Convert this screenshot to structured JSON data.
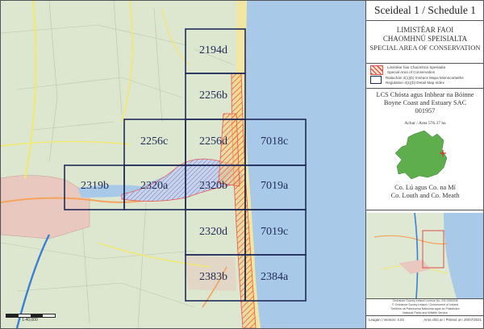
{
  "map": {
    "tiles": [
      {
        "id": "2194d",
        "label": "2194d"
      },
      {
        "id": "2256b",
        "label": "2256b"
      },
      {
        "id": "2256c",
        "label": "2256c"
      },
      {
        "id": "2256d",
        "label": "2256d"
      },
      {
        "id": "7018c",
        "label": "7018c"
      },
      {
        "id": "2319b",
        "label": "2319b"
      },
      {
        "id": "2320a",
        "label": "2320a"
      },
      {
        "id": "2320b",
        "label": "2320b"
      },
      {
        "id": "7019a",
        "label": "7019a"
      },
      {
        "id": "2320d",
        "label": "2320d"
      },
      {
        "id": "7019c",
        "label": "7019c"
      },
      {
        "id": "2383b",
        "label": "2383b"
      },
      {
        "id": "2384a",
        "label": "2384a"
      }
    ],
    "scale_text": "1:40,000",
    "colors": {
      "sea": "#a8c9e8",
      "land": "#dde6cf",
      "grid": "#1f2b57",
      "sac_hatch": "#e8544f",
      "sac_fill": "#f3d27a",
      "sand": "#f3e6a3"
    }
  },
  "panel": {
    "title": "Sceideal 1 / Schedule 1",
    "heading_ga_1": "LIMISTÉAR FAOI",
    "heading_ga_2": "CHAOMHNÚ SPEISIALTA",
    "heading_en": "SPECIAL AREA OF CONSERVATION",
    "legend": [
      {
        "text_ga": "Limistéar faoi Chaomhnú Speisialta",
        "text_en": "Special Area of Conservation"
      },
      {
        "text_ga": "Rialachán 4(1)(b) Innéacs Mapa Mionscartaithe",
        "text_en": "Regulation 4(1)(b) Detail Map Index"
      }
    ],
    "site_ga": "LCS Chósta agus Inbhear na Bóinne",
    "site_en": "Boyne Coast and Estuary SAC",
    "site_code": "001957",
    "area": "Achar / Area 576.37 ha",
    "county_ga": "Co. Lú agus Co. na Mí",
    "county_en": "Co. Louth and Co. Meath",
    "footer_lines": [
      "Ordnance Survey Ireland Licence No. EN 0059208",
      "© Ordnance Survey Ireland / Government of Ireland",
      "Seirbhís na Páirceanna Náisiúnta agus an Fhiadhúlra",
      "National Parks and Wildlife Service"
    ],
    "version": "Leagan / Version: 3.02",
    "printed": "Arna chló ar / Printed on: 20/07/2021"
  }
}
